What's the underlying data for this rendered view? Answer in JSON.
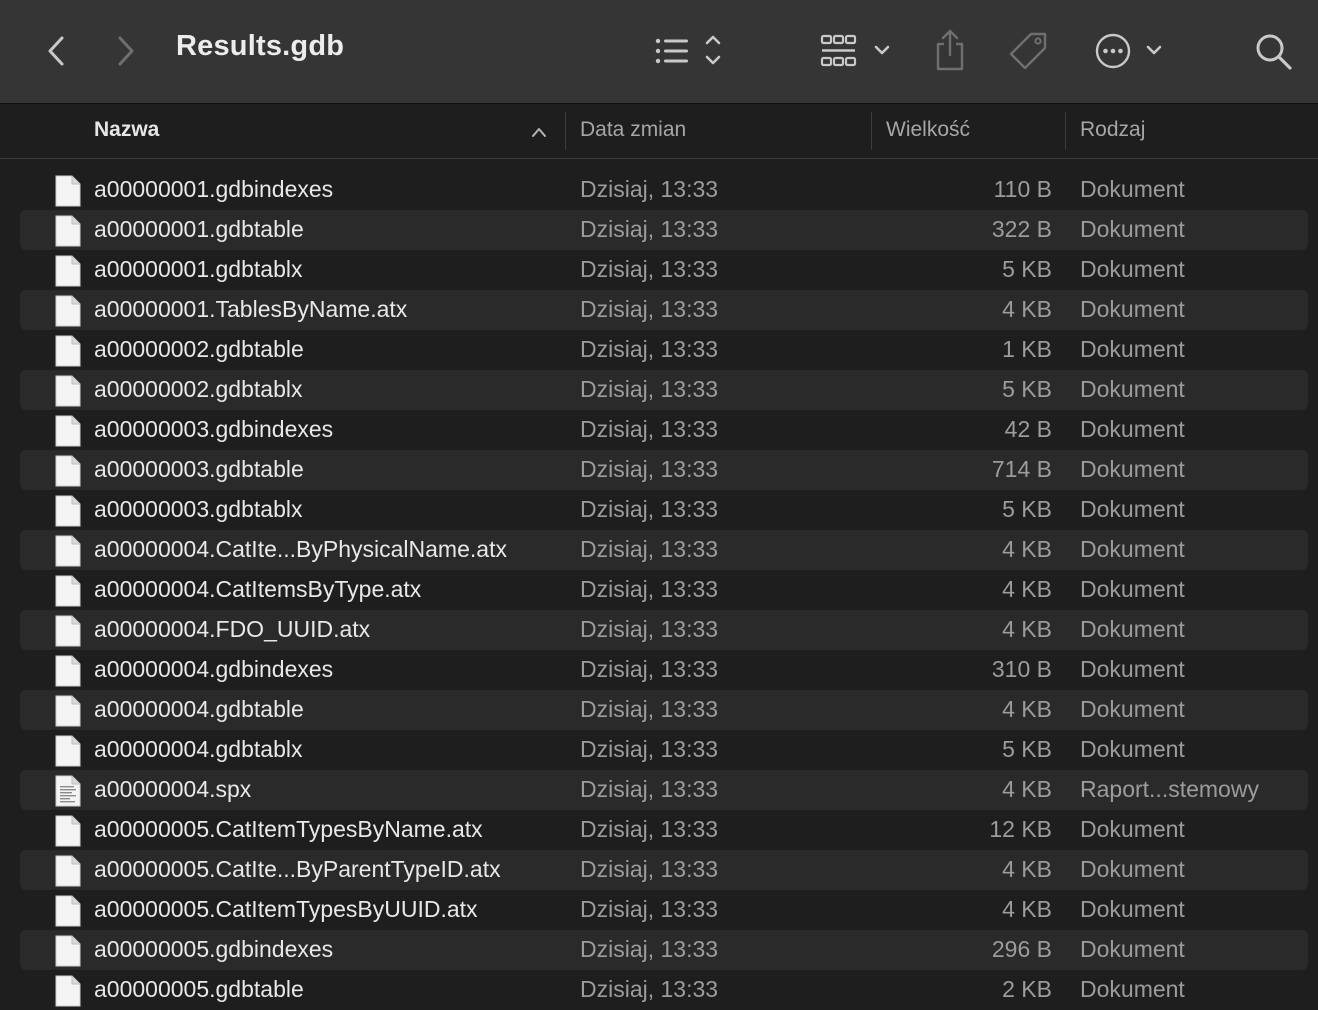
{
  "window": {
    "title": "Results.gdb"
  },
  "toolbar": {
    "back": "chevron-left-icon",
    "forward": "chevron-right-icon",
    "view_list": "list-view-icon",
    "view_grid": "grid-view-icon",
    "share": "share-icon",
    "tag": "tag-icon",
    "more": "ellipsis-circle-icon",
    "search": "search-icon"
  },
  "columns": {
    "name": "Nazwa",
    "date": "Data zmian",
    "size": "Wielkość",
    "kind": "Rodzaj"
  },
  "files": [
    {
      "name": "a00000001.gdbindexes",
      "date": "Dzisiaj, 13:33",
      "size": "110 B",
      "kind": "Dokument"
    },
    {
      "name": "a00000001.gdbtable",
      "date": "Dzisiaj, 13:33",
      "size": "322 B",
      "kind": "Dokument"
    },
    {
      "name": "a00000001.gdbtablx",
      "date": "Dzisiaj, 13:33",
      "size": "5 KB",
      "kind": "Dokument"
    },
    {
      "name": "a00000001.TablesByName.atx",
      "date": "Dzisiaj, 13:33",
      "size": "4 KB",
      "kind": "Dokument"
    },
    {
      "name": "a00000002.gdbtable",
      "date": "Dzisiaj, 13:33",
      "size": "1 KB",
      "kind": "Dokument"
    },
    {
      "name": "a00000002.gdbtablx",
      "date": "Dzisiaj, 13:33",
      "size": "5 KB",
      "kind": "Dokument"
    },
    {
      "name": "a00000003.gdbindexes",
      "date": "Dzisiaj, 13:33",
      "size": "42 B",
      "kind": "Dokument"
    },
    {
      "name": "a00000003.gdbtable",
      "date": "Dzisiaj, 13:33",
      "size": "714 B",
      "kind": "Dokument"
    },
    {
      "name": "a00000003.gdbtablx",
      "date": "Dzisiaj, 13:33",
      "size": "5 KB",
      "kind": "Dokument"
    },
    {
      "name": "a00000004.CatIte...ByPhysicalName.atx",
      "date": "Dzisiaj, 13:33",
      "size": "4 KB",
      "kind": "Dokument"
    },
    {
      "name": "a00000004.CatItemsByType.atx",
      "date": "Dzisiaj, 13:33",
      "size": "4 KB",
      "kind": "Dokument"
    },
    {
      "name": "a00000004.FDO_UUID.atx",
      "date": "Dzisiaj, 13:33",
      "size": "4 KB",
      "kind": "Dokument"
    },
    {
      "name": "a00000004.gdbindexes",
      "date": "Dzisiaj, 13:33",
      "size": "310 B",
      "kind": "Dokument"
    },
    {
      "name": "a00000004.gdbtable",
      "date": "Dzisiaj, 13:33",
      "size": "4 KB",
      "kind": "Dokument"
    },
    {
      "name": "a00000004.gdbtablx",
      "date": "Dzisiaj, 13:33",
      "size": "5 KB",
      "kind": "Dokument"
    },
    {
      "name": "a00000004.spx",
      "date": "Dzisiaj, 13:33",
      "size": "4 KB",
      "kind": "Raport...stemowy",
      "icon": "report-file-icon"
    },
    {
      "name": "a00000005.CatItemTypesByName.atx",
      "date": "Dzisiaj, 13:33",
      "size": "12 KB",
      "kind": "Dokument"
    },
    {
      "name": "a00000005.CatIte...ByParentTypeID.atx",
      "date": "Dzisiaj, 13:33",
      "size": "4 KB",
      "kind": "Dokument"
    },
    {
      "name": "a00000005.CatItemTypesByUUID.atx",
      "date": "Dzisiaj, 13:33",
      "size": "4 KB",
      "kind": "Dokument"
    },
    {
      "name": "a00000005.gdbindexes",
      "date": "Dzisiaj, 13:33",
      "size": "296 B",
      "kind": "Dokument"
    },
    {
      "name": "a00000005.gdbtable",
      "date": "Dzisiaj, 13:33",
      "size": "2 KB",
      "kind": "Dokument"
    }
  ]
}
